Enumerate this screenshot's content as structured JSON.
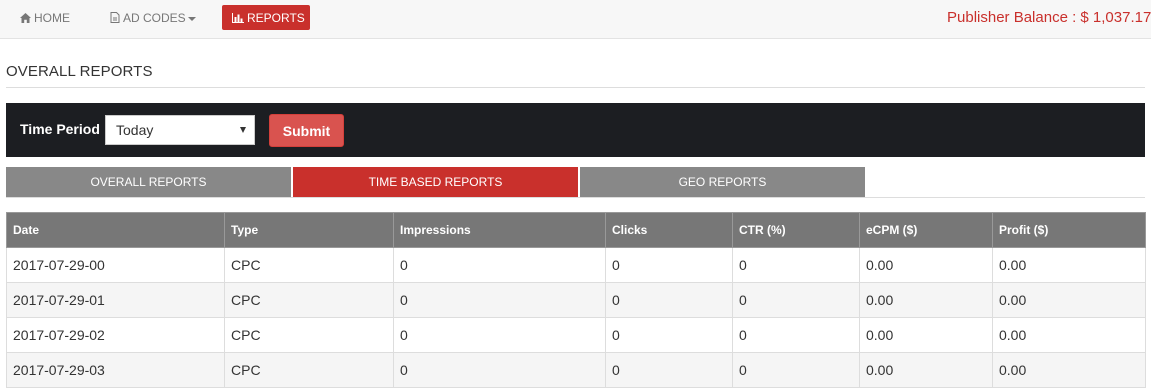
{
  "nav": {
    "home_label": "HOME",
    "adcodes_label": "AD CODES",
    "reports_label": "REPORTS",
    "balance_text": "Publisher Balance : $ 1,037.17"
  },
  "page": {
    "title": "OVERALL REPORTS"
  },
  "filter": {
    "label": "Time Period",
    "selected": "Today",
    "submit_label": "Submit"
  },
  "tabs": [
    {
      "label": "OVERALL REPORTS",
      "active": false
    },
    {
      "label": "TIME BASED REPORTS",
      "active": true
    },
    {
      "label": "GEO REPORTS",
      "active": false
    }
  ],
  "table": {
    "headers": [
      "Date",
      "Type",
      "Impressions",
      "Clicks",
      "CTR (%)",
      "eCPM ($)",
      "Profit ($)"
    ],
    "rows": [
      [
        "2017-07-29-00",
        "CPC",
        "0",
        "0",
        "0",
        "0.00",
        "0.00"
      ],
      [
        "2017-07-29-01",
        "CPC",
        "0",
        "0",
        "0",
        "0.00",
        "0.00"
      ],
      [
        "2017-07-29-02",
        "CPC",
        "0",
        "0",
        "0",
        "0.00",
        "0.00"
      ],
      [
        "2017-07-29-03",
        "CPC",
        "0",
        "0",
        "0",
        "0.00",
        "0.00"
      ]
    ]
  },
  "colors": {
    "accent": "#c9302c",
    "submit": "#d9534f",
    "filter_bg": "#1c1e22",
    "tab_bg": "#888888",
    "header_bg": "#777777"
  }
}
